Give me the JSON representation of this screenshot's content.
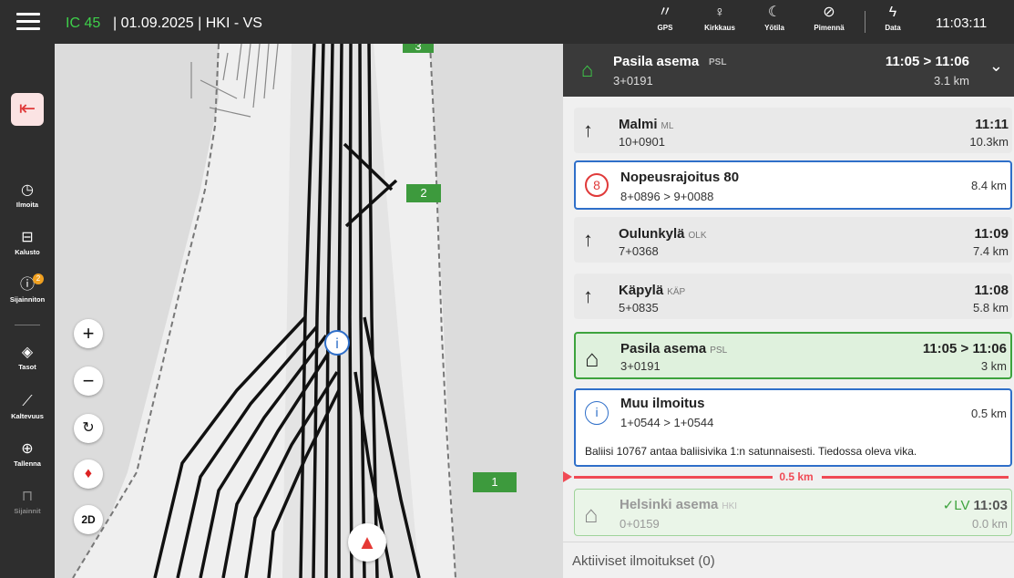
{
  "header": {
    "train_id": "IC 45",
    "trip": "| 01.09.2025 | HKI - VS",
    "status_items": [
      {
        "icon": "gps-icon",
        "label": "GPS"
      },
      {
        "icon": "brightness-icon",
        "label": "Kirkkaus"
      },
      {
        "icon": "night-mode-icon",
        "label": "Yötila"
      },
      {
        "icon": "dim-icon",
        "label": "Pimennä"
      }
    ],
    "data_label": "Data",
    "clock": "11:03:11"
  },
  "sidebar": {
    "items": [
      {
        "icon": "history-icon",
        "label": "Ilmoita"
      },
      {
        "icon": "train-icon",
        "label": "Kalusto"
      },
      {
        "icon": "info-icon",
        "label": "Sijainniton",
        "badge": "2"
      },
      {
        "icon": "layers-icon",
        "label": "Tasot"
      },
      {
        "icon": "slope-chart-icon",
        "label": "Kaltevuus"
      },
      {
        "icon": "target-icon",
        "label": "Tallenna"
      },
      {
        "icon": "bookmark-icon",
        "label": "Sijainnit"
      }
    ]
  },
  "map": {
    "km_markers": [
      "3",
      "2",
      "1"
    ],
    "zoom_in": "+",
    "zoom_out": "−",
    "view_mode": "2D"
  },
  "panel": {
    "current": {
      "name": "Pasila asema",
      "code": "PSL",
      "km": "3+0191",
      "time": "11:05 > 11:06",
      "distance": "3.1 km"
    },
    "items": [
      {
        "type": "station",
        "name": "Malmi",
        "code": "ML",
        "km": "10+0901",
        "time": "11:11",
        "distance": "10.3km"
      },
      {
        "type": "speed",
        "speed": "8",
        "name": "Nopeusrajoitus 80",
        "km": "8+0896 > 9+0088",
        "distance": "8.4 km"
      },
      {
        "type": "station",
        "name": "Oulunkylä",
        "code": "OLK",
        "km": "7+0368",
        "time": "11:09",
        "distance": "7.4 km"
      },
      {
        "type": "station",
        "name": "Käpylä",
        "code": "KÄP",
        "km": "5+0835",
        "time": "11:08",
        "distance": "5.8 km"
      },
      {
        "type": "current",
        "name": "Pasila asema",
        "code": "PSL",
        "km": "3+0191",
        "time": "11:05 > 11:06",
        "distance": "3 km"
      },
      {
        "type": "notice",
        "name": "Muu ilmoitus",
        "km": "1+0544 > 1+0544",
        "distance": "0.5 km",
        "text": "Baliisi 10767 antaa baliisivika 1:n satunnaisesti. Tiedossa oleva vika."
      },
      {
        "type": "past",
        "name": "Helsinki asema",
        "code": "HKI",
        "km": "0+0159",
        "status": "✓LV",
        "time": "11:03",
        "distance": "0.0 km"
      }
    ],
    "progress_label": "0.5 km",
    "footer": "Aktiiviset ilmoitukset (0)"
  }
}
